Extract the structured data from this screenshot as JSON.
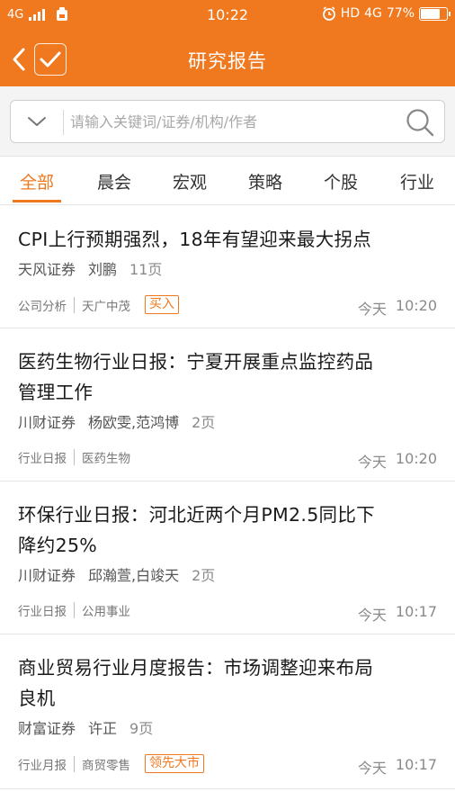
{
  "status_bar": {
    "network": "4G",
    "time": "10:22",
    "hd": "HD",
    "network_right": "4G",
    "battery": "77%",
    "battery_level": 0.77,
    "icons": [
      "signal-icon",
      "sim-icon",
      "alarm-icon",
      "battery-icon"
    ]
  },
  "nav": {
    "title": "研究报告",
    "back_icon": "chevron-left-icon",
    "check_icon": "checkmark-icon"
  },
  "search": {
    "placeholder": "请输入关键词/证券/机构/作者",
    "value": ""
  },
  "tabs": [
    "全部",
    "晨会",
    "宏观",
    "策略",
    "个股",
    "行业"
  ],
  "active_tab": "全部",
  "reports": [
    {
      "title_lines": [
        "CPI上行预期强烈，18年有望迎来最大拐点"
      ],
      "broker": "天风证券",
      "author": "刘鹏",
      "pages": "11页",
      "tags": [
        "公司分析",
        "天广中茂"
      ],
      "rating": "买入",
      "day": "今天",
      "time": "10:20"
    },
    {
      "title_lines": [
        "医药生物行业日报：宁夏开展重点监控药品",
        "管理工作"
      ],
      "broker": "川财证券",
      "author": "杨欧雯,范鸿博",
      "pages": "2页",
      "tags": [
        "行业日报",
        "医药生物"
      ],
      "rating": "",
      "day": "今天",
      "time": "10:20"
    },
    {
      "title_lines": [
        "环保行业日报：河北近两个月PM2.5同比下",
        "降约25%"
      ],
      "broker": "川财证券",
      "author": "邱瀚萱,白竣天",
      "pages": "2页",
      "tags": [
        "行业日报",
        "公用事业"
      ],
      "rating": "",
      "day": "今天",
      "time": "10:17"
    },
    {
      "title_lines": [
        "商业贸易行业月度报告：市场调整迎来布局",
        "良机"
      ],
      "broker": "财富证券",
      "author": "许正",
      "pages": "9页",
      "tags": [
        "行业月报",
        "商贸零售"
      ],
      "rating": "领先大市",
      "day": "今天",
      "time": "10:17"
    }
  ],
  "colors": {
    "accent": "#f0781e",
    "text": "#1a1a1a",
    "muted": "#8a8a8a"
  }
}
